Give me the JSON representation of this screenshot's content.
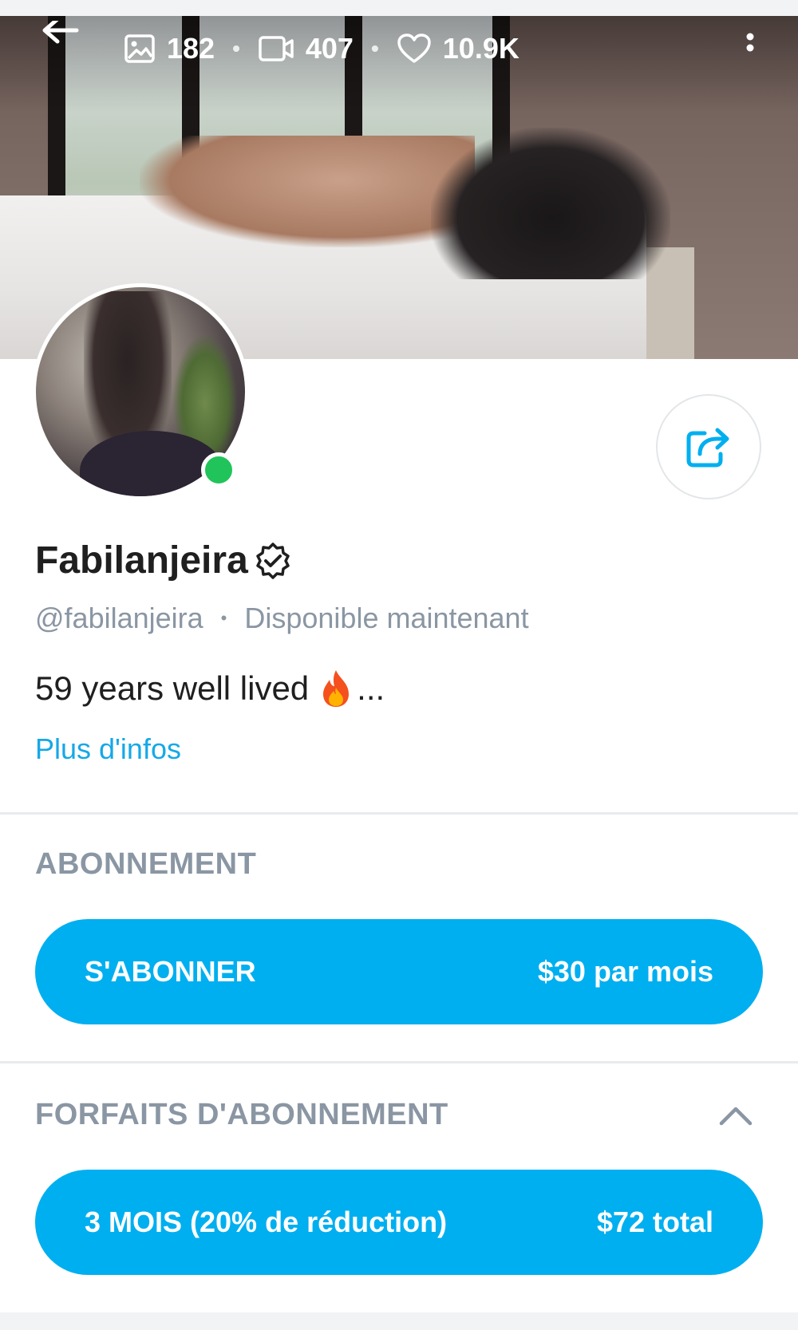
{
  "stats": {
    "images": "182",
    "videos": "407",
    "likes": "10.9K",
    "separator": "•"
  },
  "profile": {
    "name": "Fabilanjeira",
    "handle": "@fabilanjeira",
    "status": "Disponible maintenant",
    "separator": "•",
    "bio": "59 years well lived",
    "bio_suffix": "...",
    "more_info": "Plus d'infos"
  },
  "subscription": {
    "title": "ABONNEMENT",
    "subscribe_label": "S'ABONNER",
    "subscribe_price": "$30 par mois"
  },
  "bundles": {
    "title": "FORFAITS D'ABONNEMENT",
    "items": [
      {
        "label": "3 MOIS (20% de réduction)",
        "price": "$72 total"
      }
    ]
  },
  "colors": {
    "accent": "#00aff0",
    "link": "#16a8e7",
    "online": "#21c45a",
    "muted": "#8a96a3"
  },
  "icons": [
    "back-arrow-icon",
    "image-icon",
    "video-icon",
    "heart-icon",
    "more-vertical-icon",
    "share-icon",
    "verified-badge-icon",
    "flame-icon",
    "chevron-up-icon"
  ]
}
